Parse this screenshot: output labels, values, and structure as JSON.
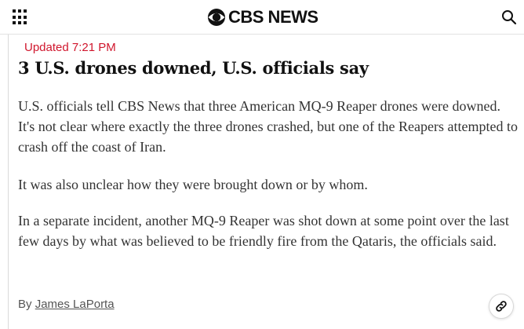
{
  "header": {
    "brand_text": "CBS NEWS",
    "menu_icon": "grid-menu-icon",
    "search_icon": "search-icon"
  },
  "article": {
    "updated": "Updated 7:21 PM",
    "headline": "3 U.S. drones downed, U.S. officials say",
    "paragraphs": [
      "U.S. officials tell CBS News that three American MQ-9 Reaper drones were downed. It's not clear where exactly the three drones crashed, but one of the Reapers attempted to crash off the coast of Iran.",
      "It was also unclear how they were brought down or by whom.",
      "In a separate incident, another MQ-9 Reaper was shot down at some point over the last few days by what was believed to be friendly fire from the Qataris, the officials said."
    ],
    "byline_prefix": "By",
    "author": "James LaPorta",
    "share_icon": "link-icon"
  },
  "colors": {
    "accent_red": "#d0162d",
    "text_dark": "#111111",
    "body_text": "#333333"
  }
}
